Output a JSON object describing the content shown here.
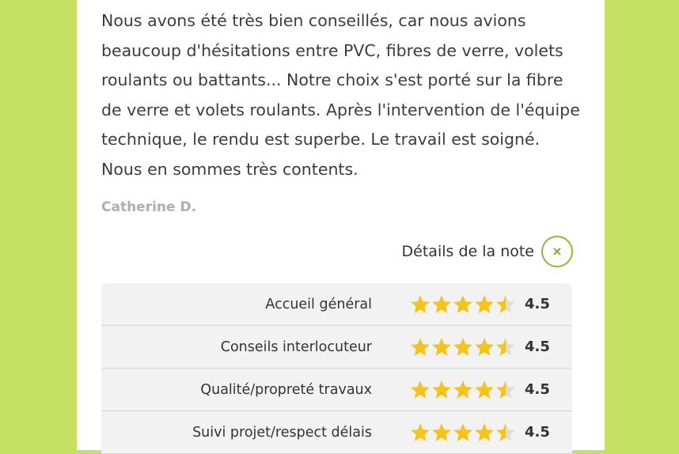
{
  "review": {
    "text": "Nous avons été très bien conseillés, car nous avions beaucoup d'hésitations entre PVC, fibres de verre, volets roulants ou battants... Notre choix s'est porté sur la fibre de verre et volets roulants. Après l'intervention de l'équipe technique, le rendu est superbe. Le travail est soigné. Nous en sommes très contents.",
    "author": "Catherine D."
  },
  "details": {
    "label": "Détails de la note",
    "close_icon": "close-icon",
    "close_glyph": "×"
  },
  "ratings": [
    {
      "label": "Accueil général",
      "value": "4.5",
      "stars": 4.5
    },
    {
      "label": "Conseils interlocuteur",
      "value": "4.5",
      "stars": 4.5
    },
    {
      "label": "Qualité/propreté travaux",
      "value": "4.5",
      "stars": 4.5
    },
    {
      "label": "Suivi projet/respect délais",
      "value": "4.5",
      "stars": 4.5
    }
  ],
  "colors": {
    "background": "#c6e063",
    "star_filled": "#f6c31c",
    "star_empty": "#dddddd",
    "accent": "#8fb834"
  }
}
